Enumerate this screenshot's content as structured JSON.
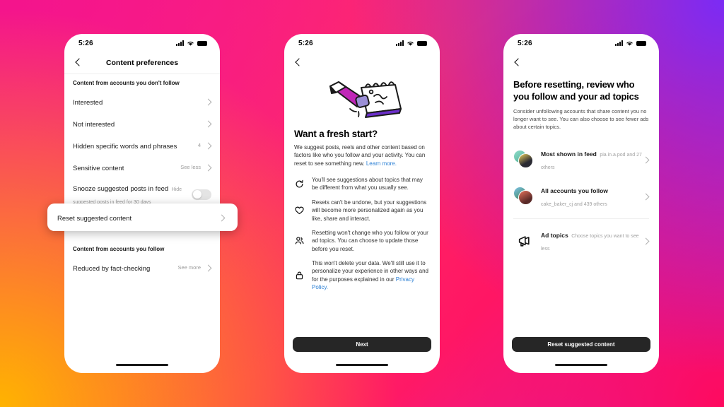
{
  "background": {
    "gradient_colors": [
      "#f4148c",
      "#7b2bf5",
      "#ff0a5e",
      "#ffb300",
      "#ff2e63"
    ]
  },
  "accent_colors": {
    "link": "#2a7fd4",
    "button": "#262626",
    "muted_text": "#9a9a9a",
    "pencil_body": "#c026b8",
    "pencil_eraser": "#9b8fd6",
    "notebook_edge": "#6b2fc9"
  },
  "status_bar": {
    "time": "5:26",
    "signal_icon": "cellular-signal-icon",
    "wifi_icon": "wifi-icon",
    "battery_icon": "battery-icon"
  },
  "screen1": {
    "nav": {
      "back_icon": "back-chevron-icon",
      "title": "Content preferences"
    },
    "section1_header": "Content from accounts you don't follow",
    "rows": [
      {
        "title": "Interested",
        "sub": "",
        "meta": "",
        "control": "chevron"
      },
      {
        "title": "Not interested",
        "sub": "",
        "meta": "",
        "control": "chevron"
      },
      {
        "title": "Hidden specific words and phrases",
        "sub": "",
        "meta": "4",
        "control": "chevron"
      },
      {
        "title": "Sensitive content",
        "sub": "",
        "meta": "See less",
        "control": "chevron"
      },
      {
        "title": "Snooze suggested posts in feed",
        "sub": "Hide suggested posts in feed for 30 days",
        "meta": "",
        "control": "toggle"
      }
    ],
    "toggle_state": "off",
    "highlighted_row": {
      "title": "Reset suggested content",
      "control": "chevron"
    },
    "section2_header": "Content from accounts you follow",
    "rows2": [
      {
        "title": "Reduced by fact-checking",
        "sub": "",
        "meta": "See more",
        "control": "chevron"
      }
    ]
  },
  "screen2": {
    "nav": {
      "back_icon": "back-chevron-icon"
    },
    "illustration": "pencil-erasing-notebook-illustration",
    "heading": "Want a fresh start?",
    "lede": "We suggest posts, reels and other content based on factors like who you follow and your activity. You can reset to see something new. ",
    "lede_link": "Learn more.",
    "bullets": [
      {
        "icon": "refresh-icon",
        "text": "You'll see suggestions about topics that may be different from what you usually see."
      },
      {
        "icon": "heart-icon",
        "text": "Resets can't be undone, but your suggestions will become more personalized again as you like, share and interact."
      },
      {
        "icon": "people-icon",
        "text": "Resetting won't change who you follow or your ad topics. You can choose to update those before you reset."
      },
      {
        "icon": "lock-icon",
        "text": "This won't delete your data. We'll still use it to personalize your experience in other ways and for the purposes explained in our ",
        "link": "Privacy Policy."
      }
    ],
    "cta_label": "Next"
  },
  "screen3": {
    "nav": {
      "back_icon": "back-chevron-icon"
    },
    "heading": "Before resetting, review who you follow and your ad topics",
    "lede": "Consider unfollowing accounts that share content you no longer want to see. You can also choose to see fewer ads about certain topics.",
    "account_rows": [
      {
        "title": "Most shown in feed",
        "sub": "pia.in.a.pod and 27 others",
        "avatar_back": "#7fd4c8",
        "avatar_front": "#e8c24a",
        "avatar_icon": "avatar-stack"
      },
      {
        "title": "All accounts you follow",
        "sub": "cake_baker_cj and 439 others",
        "avatar_back": "#5fa8d8",
        "avatar_front": "#e0604f",
        "avatar_icon": "avatar-stack"
      }
    ],
    "ad_row": {
      "icon": "megaphone-icon",
      "title": "Ad topics",
      "sub": "Choose topics you want to see less"
    },
    "cta_label": "Reset suggested content"
  }
}
